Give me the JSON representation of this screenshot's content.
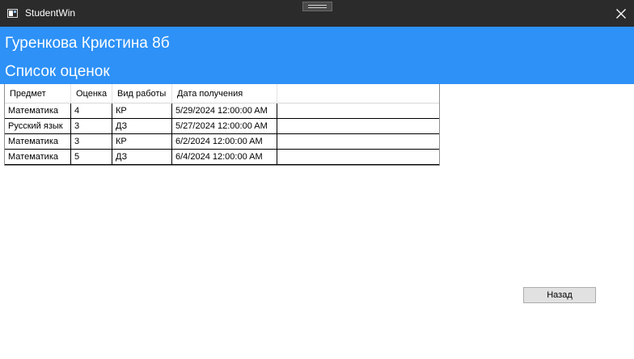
{
  "window": {
    "title": "StudentWin",
    "title_icon": "app-window-icon",
    "close_icon": "close-icon"
  },
  "header": {
    "student_name": "Гуренкова Кристина 8б",
    "section_title": "Список оценок",
    "background_color": "#2d91f7"
  },
  "grid": {
    "columns": [
      "Предмет",
      "Оценка",
      "Вид работы",
      "Дата получения"
    ],
    "rows": [
      [
        "Математика",
        "4",
        "КР",
        "5/29/2024 12:00:00 AM"
      ],
      [
        "Русский язык",
        "3",
        "ДЗ",
        "5/27/2024 12:00:00 AM"
      ],
      [
        "Математика",
        "3",
        "КР",
        "6/2/2024 12:00:00 AM"
      ],
      [
        "Математика",
        "5",
        "ДЗ",
        "6/4/2024 12:00:00 AM"
      ]
    ]
  },
  "actions": {
    "back_label": "Назад"
  }
}
